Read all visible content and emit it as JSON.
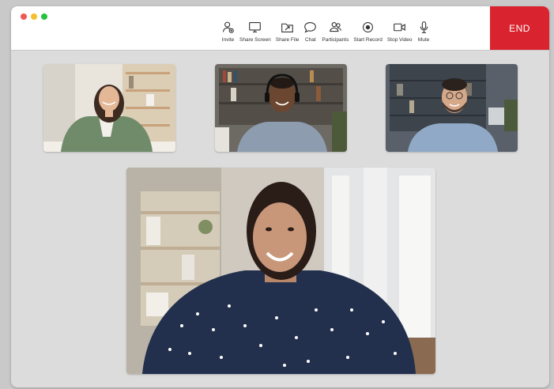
{
  "window": {
    "title": ""
  },
  "traffic_lights": {
    "close": "#ee5b57",
    "minimize": "#f4c02e",
    "maximize": "#29c240"
  },
  "toolbar": {
    "items": [
      {
        "label": "Invite",
        "icon": "invite-icon"
      },
      {
        "label": "Share Screen",
        "icon": "monitor-icon"
      },
      {
        "label": "Share File",
        "icon": "folder-share-icon"
      },
      {
        "label": "Chat",
        "icon": "chat-bubble-icon"
      },
      {
        "label": "Participants",
        "icon": "participants-icon"
      },
      {
        "label": "Start Record",
        "icon": "record-icon"
      },
      {
        "label": "Stop Video",
        "icon": "video-camera-icon"
      },
      {
        "label": "Mute",
        "icon": "microphone-icon"
      }
    ],
    "end_label": "END",
    "end_color": "#d9232e"
  },
  "participants": [
    {
      "name": "",
      "description": "woman in green cardigan at desk, bright room with shelves"
    },
    {
      "name": "",
      "description": "man with headset smiling, bookshelf background"
    },
    {
      "name": "",
      "description": "man with glasses in blue shirt, dark shelves background"
    }
  ],
  "main_speaker": {
    "name": "",
    "description": "smiling woman in navy polka-dot blouse, living room background"
  }
}
